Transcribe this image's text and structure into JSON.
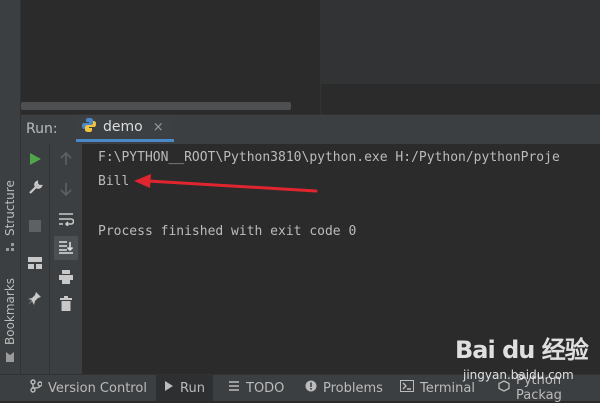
{
  "left_stripe": {
    "structure_label": "Structure",
    "bookmarks_label": "Bookmarks"
  },
  "run_panel": {
    "title": "Run:",
    "tab_label": "demo",
    "tab_close": "×"
  },
  "console": {
    "lines": [
      "F:\\PYTHON__ROOT\\Python3810\\python.exe H:/Python/pythonProje",
      "Bill",
      "",
      "Process finished with exit code 0"
    ]
  },
  "bottom_bar": {
    "items": [
      "Version Control",
      "Run",
      "TODO",
      "Problems",
      "Terminal",
      "Python Packag"
    ]
  },
  "watermark": {
    "brand": "Bai du 经验",
    "url": "jingyan.baidu.com"
  },
  "colors": {
    "accent": "#4a88c7",
    "arrow": "#e0252f",
    "run_green": "#4fa64a"
  }
}
